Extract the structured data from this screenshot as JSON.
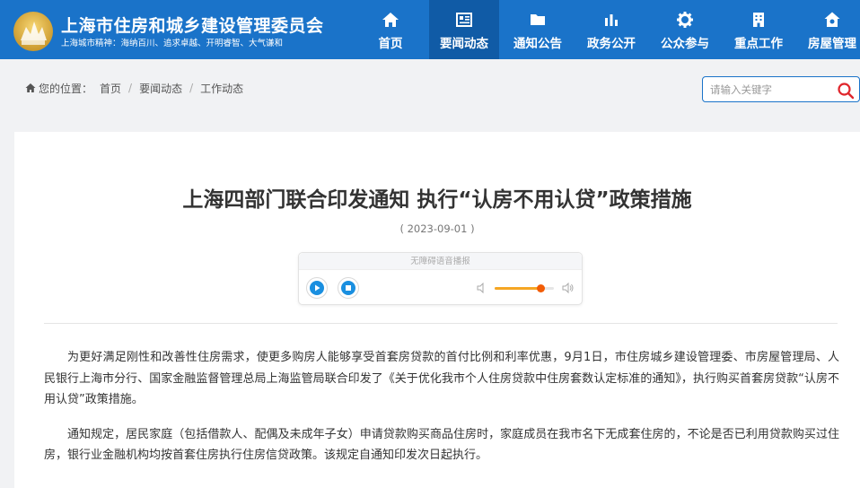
{
  "site": {
    "title": "上海市住房和城乡建设管理委员会",
    "motto": "上海城市精神：海纳百川、追求卓越、开明睿智、大气谦和"
  },
  "nav": {
    "items": [
      {
        "label": "首页",
        "icon": "home-icon"
      },
      {
        "label": "要闻动态",
        "icon": "news-icon",
        "active": true
      },
      {
        "label": "通知公告",
        "icon": "folder-icon"
      },
      {
        "label": "政务公开",
        "icon": "chart-icon"
      },
      {
        "label": "公众参与",
        "icon": "gear-icon"
      },
      {
        "label": "重点工作",
        "icon": "building-icon"
      },
      {
        "label": "房屋管理",
        "icon": "house-icon"
      }
    ]
  },
  "breadcrumb": {
    "prefix": "您的位置：",
    "items": [
      "首页",
      "要闻动态",
      "工作动态"
    ],
    "separator": "/"
  },
  "search": {
    "placeholder": "请输入关键字"
  },
  "article": {
    "title": "上海四部门联合印发通知 执行“认房不用认贷”政策措施",
    "date": "( 2023-09-01 )",
    "paragraphs": [
      "为更好满足刚性和改善性住房需求，使更多购房人能够享受首套房贷款的首付比例和利率优惠，9月1日，市住房城乡建设管理委、市房屋管理局、人民银行上海市分行、国家金融监督管理总局上海监管局联合印发了《关于优化我市个人住房贷款中住房套数认定标准的通知》，执行购买首套房贷款“认房不用认贷”政策措施。",
      "通知规定，居民家庭（包括借款人、配偶及未成年子女）申请贷款购买商品住房时，家庭成员在我市名下无成套住房的，不论是否已利用贷款购买过住房，银行业金融机构均按首套住房执行住房信贷政策。该规定自通知印发次日起执行。"
    ]
  },
  "player": {
    "label": "无障碍语音播报",
    "volume": 0.78
  },
  "colors": {
    "header_bg": "#1a73c9",
    "nav_active_bg": "#105ba6",
    "volume_fill": "#f5a623",
    "volume_thumb": "#f25c05",
    "search_icon": "#e0262c"
  }
}
